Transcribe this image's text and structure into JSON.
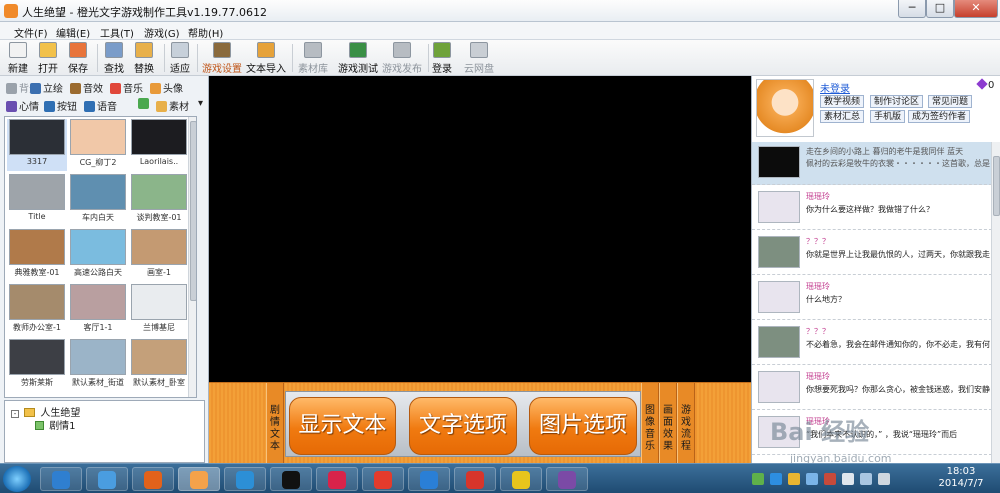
{
  "window": {
    "title": "人生绝望 - 橙光文字游戏制作工具v1.19.77.0612",
    "minimize": "─",
    "maximize": "□",
    "close": "✕"
  },
  "menu": [
    "文件(F)",
    "编辑(E)",
    "工具(T)",
    "游戏(G)",
    "帮助(H)"
  ],
  "toolbar": [
    {
      "label": "新建",
      "icon": "new-file-icon",
      "state": "normal"
    },
    {
      "label": "打开",
      "icon": "open-folder-icon",
      "state": "normal"
    },
    {
      "label": "保存",
      "icon": "save-icon",
      "state": "normal"
    },
    {
      "label": "查找",
      "icon": "find-icon",
      "state": "normal"
    },
    {
      "label": "替换",
      "icon": "replace-icon",
      "state": "normal"
    },
    {
      "label": "适应",
      "icon": "fit-icon",
      "state": "normal"
    },
    {
      "label": "游戏设置",
      "icon": "gear-icon",
      "state": "highlight"
    },
    {
      "label": "文本导入",
      "icon": "import-icon",
      "state": "normal"
    },
    {
      "label": "素材库",
      "icon": "library-icon",
      "state": "disabled"
    },
    {
      "label": "游戏测试",
      "icon": "play-icon",
      "state": "normal"
    },
    {
      "label": "游戏发布",
      "icon": "publish-icon",
      "state": "disabled"
    },
    {
      "label": "登录",
      "icon": "login-icon",
      "state": "normal"
    },
    {
      "label": "云网盘",
      "icon": "cloud-icon",
      "state": "disabled"
    }
  ],
  "categories_row1": [
    {
      "label": "背景",
      "icon": "background-icon",
      "state": "disabled"
    },
    {
      "label": "立绘",
      "icon": "portrait-icon",
      "state": "normal"
    },
    {
      "label": "音效",
      "icon": "sound-effect-icon",
      "state": "normal"
    },
    {
      "label": "音乐",
      "icon": "music-icon",
      "state": "normal"
    },
    {
      "label": "头像",
      "icon": "avatar-icon",
      "state": "normal"
    }
  ],
  "categories_row2": [
    {
      "label": "心情",
      "icon": "mood-icon",
      "state": "normal"
    },
    {
      "label": "按钮",
      "icon": "button-icon",
      "state": "normal"
    },
    {
      "label": "语音",
      "icon": "voice-icon",
      "state": "normal"
    },
    {
      "label": "",
      "icon": "refresh-icon",
      "state": "normal"
    },
    {
      "label": "素材",
      "icon": "material-icon",
      "state": "normal"
    }
  ],
  "thumbnails": [
    {
      "label": "3317",
      "color": "#2b2f36",
      "selected": true
    },
    {
      "label": "CG_柳丁2",
      "color": "#f1c8a8",
      "selected": false
    },
    {
      "label": "Laorilais..",
      "color": "#1c1c20",
      "selected": false
    },
    {
      "label": "Title",
      "color": "#9ea4aa",
      "selected": false
    },
    {
      "label": "车内白天",
      "color": "#5f8fb0",
      "selected": false
    },
    {
      "label": "谈判教室-01",
      "color": "#8bb58a",
      "selected": false
    },
    {
      "label": "典雅教室-01",
      "color": "#b07a4a",
      "selected": false
    },
    {
      "label": "高速公路白天",
      "color": "#7bbcdf",
      "selected": false
    },
    {
      "label": "画室-1",
      "color": "#c49a72",
      "selected": false
    },
    {
      "label": "教师办公室-1",
      "color": "#a58b6c",
      "selected": false
    },
    {
      "label": "客厅1-1",
      "color": "#b99fa0",
      "selected": false
    },
    {
      "label": "兰博基尼",
      "color": "#e9ecef",
      "selected": false
    },
    {
      "label": "劳斯莱斯",
      "color": "#3d3f45",
      "selected": false
    },
    {
      "label": "默认素材_街道",
      "color": "#9bb4c8",
      "selected": false
    },
    {
      "label": "默认素材_卧室",
      "color": "#c4a07a",
      "selected": false
    }
  ],
  "tree": {
    "root": "人生绝望",
    "child": "剧情1"
  },
  "bottom_tabs": {
    "left": "剧情文本",
    "image_music": "图像音乐",
    "screen_effect": "画面效果",
    "game_flow": "游戏流程"
  },
  "big_buttons": [
    "显示文本",
    "文字选项",
    "图片选项"
  ],
  "profile": {
    "login_link": "未登录",
    "gem_count": "0",
    "links": [
      "教学视频",
      "制作讨论区",
      "常见问题",
      "素材汇总",
      "手机版",
      "成为签约作者"
    ]
  },
  "feed": [
    {
      "name": "",
      "text": "走在乡间的小路上  暮归的老牛是我同伴  蓝天",
      "text2": "佩衬的云彩是牧牛的衣裳・・・・・・这首歌，总是",
      "thumb": "#0c0c0c",
      "top": true
    },
    {
      "name": "瑶瑶玲",
      "text": "你为什么要这样做？我做错了什么？",
      "thumb": "#e8e4ee",
      "top": false
    },
    {
      "name": "？？？",
      "text": "你就是世界上让我最仇恨的人，过两天，你就跟我走",
      "thumb": "#7d8f80",
      "top": false
    },
    {
      "name": "瑶瑶玲",
      "text": "什么地方？",
      "thumb": "#e8e4ee",
      "top": false
    },
    {
      "name": "？？？",
      "text": "不必着急，我会在邮件通知你的，你不必走，我有何",
      "thumb": "#7d8f80",
      "top": false
    },
    {
      "name": "瑶瑶玲",
      "text": "你想要死我吗？你那么贪心，被金钱迷惑，我们安静",
      "thumb": "#e8e4ee",
      "top": false
    },
    {
      "name": "瑶瑶玲",
      "text": "“我们本来不认识的，” ，我说“瑶瑶玲”而后",
      "thumb": "#e8e4ee",
      "top": false
    }
  ],
  "taskbar": {
    "time": "18:03",
    "date": "2014/7/7",
    "icons": [
      {
        "name": "explorer-icon",
        "color": "#2f7fd0"
      },
      {
        "name": "people-icon",
        "color": "#4a9de0"
      },
      {
        "name": "powerpoint-icon",
        "color": "#e2621b"
      },
      {
        "name": "orange-maker-icon",
        "color": "#f4a24a"
      },
      {
        "name": "browser-icon",
        "color": "#2c8fd6"
      },
      {
        "name": "qq-icon",
        "color": "#111111"
      },
      {
        "name": "xiu-icon",
        "color": "#d8234a"
      },
      {
        "name": "video-icon",
        "color": "#e43b2c"
      },
      {
        "name": "ie-icon",
        "color": "#2a7fd6"
      },
      {
        "name": "chrome-icon",
        "color": "#d7352b"
      },
      {
        "name": "sogou-icon",
        "color": "#e8c51c"
      },
      {
        "name": "winrar-icon",
        "color": "#7b4aa6"
      }
    ]
  },
  "watermark": {
    "main": "Bai 经验",
    "sub": "jingyan.baidu.com"
  },
  "colors": {
    "accent_orange": "#f07a10",
    "panel_bg": "#eef2f6",
    "canvas": "#000000"
  }
}
